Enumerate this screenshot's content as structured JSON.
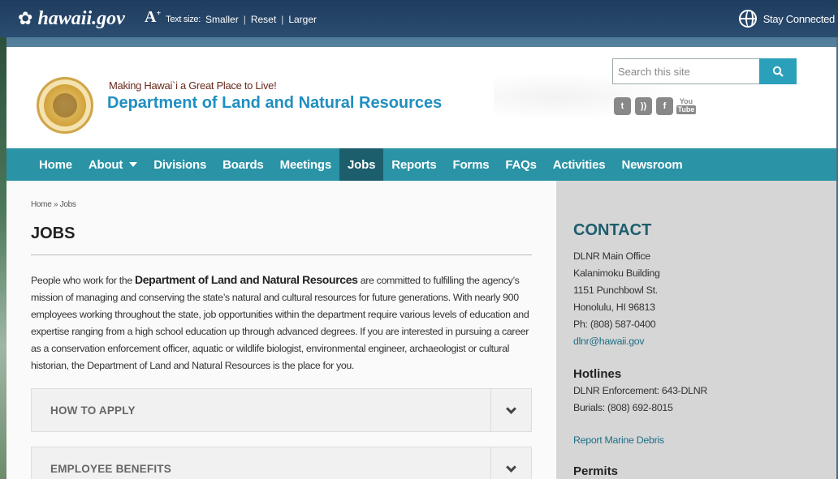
{
  "topbar": {
    "logo_text": "hawaii.gov",
    "text_size_label": "Text size:",
    "smaller": "Smaller",
    "reset": "Reset",
    "larger": "Larger",
    "stay_connected": "Stay Connected"
  },
  "header": {
    "tagline": "Making Hawai`i a Great Place to Live!",
    "department": "Department of Land and Natural Resources",
    "search_placeholder": "Search this site"
  },
  "social": {
    "twitter": "t",
    "rss": "))",
    "facebook": "f",
    "youtube_top": "You",
    "youtube_bottom": "Tube"
  },
  "nav": {
    "items": [
      {
        "label": "Home"
      },
      {
        "label": "About"
      },
      {
        "label": "Divisions"
      },
      {
        "label": "Boards"
      },
      {
        "label": "Meetings"
      },
      {
        "label": "Jobs"
      },
      {
        "label": "Reports"
      },
      {
        "label": "Forms"
      },
      {
        "label": "FAQs"
      },
      {
        "label": "Activities"
      },
      {
        "label": "Newsroom"
      }
    ]
  },
  "breadcrumb": {
    "home": "Home",
    "sep": " » ",
    "current": "Jobs"
  },
  "main": {
    "title": "JOBS",
    "intro_lead": "People who work for the ",
    "intro_bold": "Department of Land and Natural Resources",
    "intro_rest": " are committed to fulfilling the agency’s mission of managing and conserving the state’s natural and cultural resources for future generations. With nearly 900 employees working throughout the state, job opportunities within the department require various levels of education and expertise ranging from a high school education up through advanced degrees. If you are interested in pursuing a career as a conservation enforcement offi­cer, aquatic or wildlife biologist, environmental engineer, archaeologist or cultural historian, the Department of Land and Natural Re­sources is the place for you.",
    "accordions": [
      {
        "title": "HOW TO APPLY"
      },
      {
        "title": "EMPLOYEE BENEFITS"
      }
    ]
  },
  "sidebar": {
    "contact_heading": "CONTACT",
    "office": "DLNR Main Office",
    "building": "Kalanimoku Building",
    "street": "1151 Punchbowl St.",
    "city": "Honolulu, HI 96813",
    "phone": "Ph: (808) 587-0400",
    "email": "dlnr@hawaii.gov",
    "hotlines_heading": "Hotlines",
    "enforcement": "DLNR Enforcement: 643-DLNR",
    "burials": "Burials: (808) 692-8015",
    "marine_debris": "Report Marine Debris",
    "permits_heading": "Permits"
  },
  "colors": {
    "nav_bg": "#2a93a6",
    "nav_active": "#1d5e6d",
    "dept_title": "#1f8fc1",
    "topbar": "#1f3c5e"
  }
}
